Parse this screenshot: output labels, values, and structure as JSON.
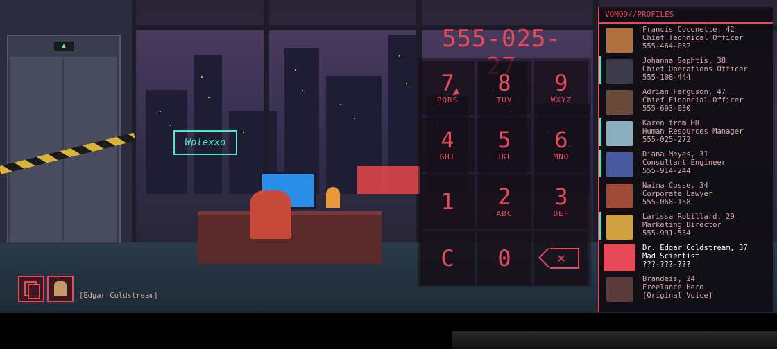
{
  "dialer": {
    "display_number": "555-025-27",
    "keys": [
      {
        "digit": "7",
        "letters": "PQRS"
      },
      {
        "digit": "8",
        "letters": "TUV"
      },
      {
        "digit": "9",
        "letters": "WXYZ"
      },
      {
        "digit": "4",
        "letters": "GHI"
      },
      {
        "digit": "5",
        "letters": "JKL"
      },
      {
        "digit": "6",
        "letters": "MNO"
      },
      {
        "digit": "1",
        "letters": ""
      },
      {
        "digit": "2",
        "letters": "ABC"
      },
      {
        "digit": "3",
        "letters": "DEF"
      },
      {
        "digit": "C",
        "letters": ""
      },
      {
        "digit": "0",
        "letters": ""
      },
      {
        "digit": "",
        "letters": "",
        "icon": "backspace-icon"
      }
    ],
    "accent_color": "#e84a5a"
  },
  "profiles": {
    "title": "VOMOD//PROFILES",
    "items": [
      {
        "name": "Francis Coconette, 42",
        "role": "Chief Technical Officer",
        "number": "555-464-032",
        "avatar_color": "#b07040"
      },
      {
        "name": "Johanna Sephtis, 38",
        "role": "Chief Operations Officer",
        "number": "555-108-444",
        "avatar_color": "#3a3a4a"
      },
      {
        "name": "Adrian Ferguson, 47",
        "role": "Chief Financial Officer",
        "number": "555-693-030",
        "avatar_color": "#6a4a3a"
      },
      {
        "name": "Karen from HR",
        "role": "Human Resources Manager",
        "number": "555-025-272",
        "avatar_color": "#8ab0c0"
      },
      {
        "name": "Diana Meyes, 31",
        "role": "Consultant Engineer",
        "number": "555-914-244",
        "avatar_color": "#4a5aa0"
      },
      {
        "name": "Naima Cosse, 34",
        "role": "Corporate Lawyer",
        "number": "555-068-158",
        "avatar_color": "#a04a3a"
      },
      {
        "name": "Larissa Robillard, 29",
        "role": "Marketing Director",
        "number": "555-991-554",
        "avatar_color": "#d0a040"
      },
      {
        "name": "Dr. Edgar Coldstream, 37",
        "role": "Mad Scientist",
        "number": "???-???-???",
        "avatar_color": "#e84a5a",
        "selected": true
      },
      {
        "name": "Brandeis, 24",
        "role": "Freelance Hero",
        "number": "[Original Voice]",
        "avatar_color": "#5a3a3a"
      }
    ]
  },
  "hud": {
    "character_label": "[Edgar Coldstream]"
  },
  "scene": {
    "neon_sign_text": "Wplexxo"
  }
}
